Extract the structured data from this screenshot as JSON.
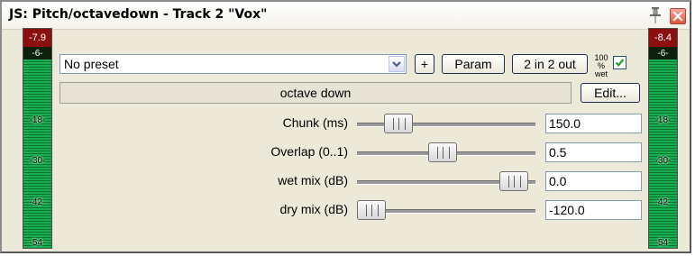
{
  "window": {
    "title": "JS: Pitch/octavedown - Track 2 \"Vox\""
  },
  "meters": {
    "input": {
      "peak": "-7.9",
      "level": 0.86,
      "ticks": [
        "-6-",
        "-18-",
        "-30-",
        "-42-",
        "-54-"
      ]
    },
    "output": {
      "peak": "-8.4",
      "level": 0.86,
      "ticks": [
        "-6-",
        "-18-",
        "-30-",
        "-42-",
        "-54-"
      ]
    }
  },
  "preset": {
    "value": "No preset"
  },
  "toolbar": {
    "add_label": "+",
    "param_label": "Param",
    "pins_label": "2 in 2 out",
    "wet_label_top": "100 %",
    "wet_label_bottom": "wet",
    "wet_enabled": true
  },
  "effect": {
    "name": "octave down",
    "edit_label": "Edit..."
  },
  "params": [
    {
      "label": "Chunk (ms)",
      "value": "150.0",
      "position": 0.23
    },
    {
      "label": "Overlap (0..1)",
      "value": "0.5",
      "position": 0.48
    },
    {
      "label": "wet mix (dB)",
      "value": "0.0",
      "position": 0.88
    },
    {
      "label": "dry mix (dB)",
      "value": "-120.0",
      "position": 0.08
    }
  ],
  "colors": {
    "meter_peak": "#8c0f0f",
    "meter_fill": "#1fd26a",
    "checkbox_check": "#20a020",
    "close_button": "#e0543b"
  }
}
